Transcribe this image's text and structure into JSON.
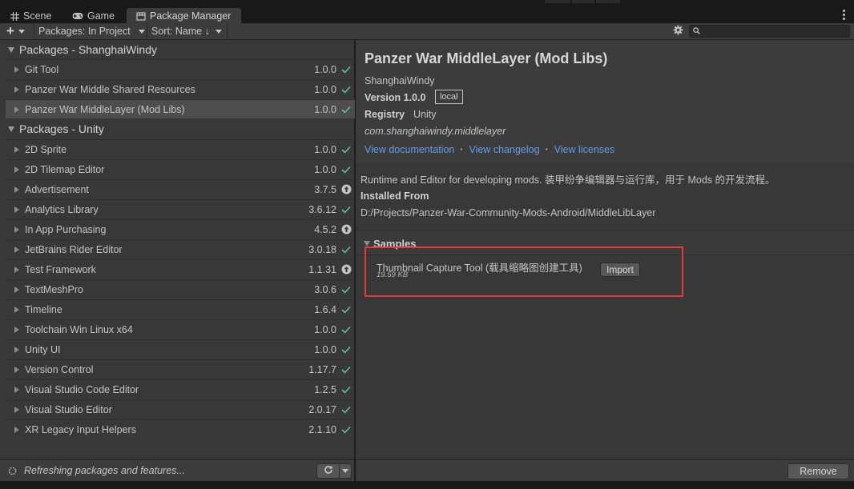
{
  "tabs": [
    {
      "label": "Scene",
      "icon": "grid-icon"
    },
    {
      "label": "Game",
      "icon": "gamepad-icon"
    },
    {
      "label": "Package Manager",
      "icon": "package-icon"
    }
  ],
  "toolbar": {
    "add_label": "+",
    "packages_filter": "Packages: In Project",
    "sort": "Sort: Name ↓",
    "search_placeholder": ""
  },
  "groups": [
    {
      "label": "Packages - ShanghaiWindy",
      "items": [
        {
          "name": "Git Tool",
          "version": "1.0.0",
          "status": "installed"
        },
        {
          "name": "Panzer War Middle Shared Resources",
          "version": "1.0.0",
          "status": "installed"
        },
        {
          "name": "Panzer War MiddleLayer (Mod Libs)",
          "version": "1.0.0",
          "status": "installed",
          "selected": true
        }
      ]
    },
    {
      "label": "Packages - Unity",
      "items": [
        {
          "name": "2D Sprite",
          "version": "1.0.0",
          "status": "installed"
        },
        {
          "name": "2D Tilemap Editor",
          "version": "1.0.0",
          "status": "installed"
        },
        {
          "name": "Advertisement",
          "version": "3.7.5",
          "status": "update"
        },
        {
          "name": "Analytics Library",
          "version": "3.6.12",
          "status": "installed"
        },
        {
          "name": "In App Purchasing",
          "version": "4.5.2",
          "status": "update"
        },
        {
          "name": "JetBrains Rider Editor",
          "version": "3.0.18",
          "status": "installed"
        },
        {
          "name": "Test Framework",
          "version": "1.1.31",
          "status": "update"
        },
        {
          "name": "TextMeshPro",
          "version": "3.0.6",
          "status": "installed"
        },
        {
          "name": "Timeline",
          "version": "1.6.4",
          "status": "installed"
        },
        {
          "name": "Toolchain Win Linux x64",
          "version": "1.0.0",
          "status": "installed"
        },
        {
          "name": "Unity UI",
          "version": "1.0.0",
          "status": "installed"
        },
        {
          "name": "Version Control",
          "version": "1.17.7",
          "status": "installed"
        },
        {
          "name": "Visual Studio Code Editor",
          "version": "1.2.5",
          "status": "installed"
        },
        {
          "name": "Visual Studio Editor",
          "version": "2.0.17",
          "status": "installed"
        },
        {
          "name": "XR Legacy Input Helpers",
          "version": "2.1.10",
          "status": "installed"
        }
      ]
    }
  ],
  "status_text": "Refreshing packages and features...",
  "detail": {
    "title": "Panzer War MiddleLayer (Mod Libs)",
    "author": "ShanghaiWindy",
    "version": "Version 1.0.0",
    "badge": "local",
    "registry_label": "Registry",
    "registry_value": "Unity",
    "package_id": "com.shanghaiwindy.middlelayer",
    "links": [
      "View documentation",
      "View changelog",
      "View licenses"
    ],
    "description": "Runtime and Editor for developing mods. 装甲纷争编辑器与运行库，用于 Mods 的开发流程。",
    "installed_from_label": "Installed From",
    "installed_from_path": "D:/Projects/Panzer-War-Community-Mods-Android/MiddleLibLayer",
    "samples_label": "Samples",
    "sample": {
      "name": "Thumbnail Capture Tool (载具缩略图创建工具)",
      "size": "19.59 KB",
      "import_label": "Import"
    },
    "remove_label": "Remove"
  },
  "colors": {
    "installed_check": "#5fbf8f",
    "update_icon": "#c4c4c4",
    "link": "#5f9ee8",
    "highlight": "#e23b3b"
  }
}
